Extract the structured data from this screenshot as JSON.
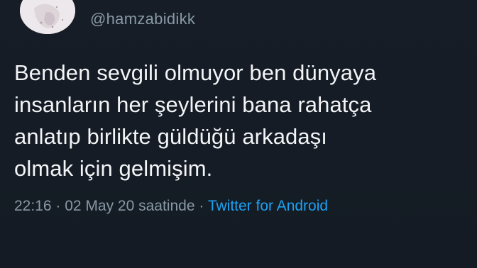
{
  "tweet": {
    "handle": "@hamzabidikk",
    "text_lines": [
      "Benden sevgili olmuyor ben dünyaya",
      "insanların her şeylerini bana rahatça",
      "anlatıp birlikte güldüğü arkadaşı",
      "olmak için gelmişim."
    ],
    "time": "22:16",
    "separator": " · ",
    "date": "02 May 20 saatinde",
    "separator2": " · ",
    "source": "Twitter for Android"
  },
  "colors": {
    "background": "#15202b",
    "text": "#f2f4f6",
    "secondary": "#8899a6",
    "link": "#1da1f2"
  }
}
